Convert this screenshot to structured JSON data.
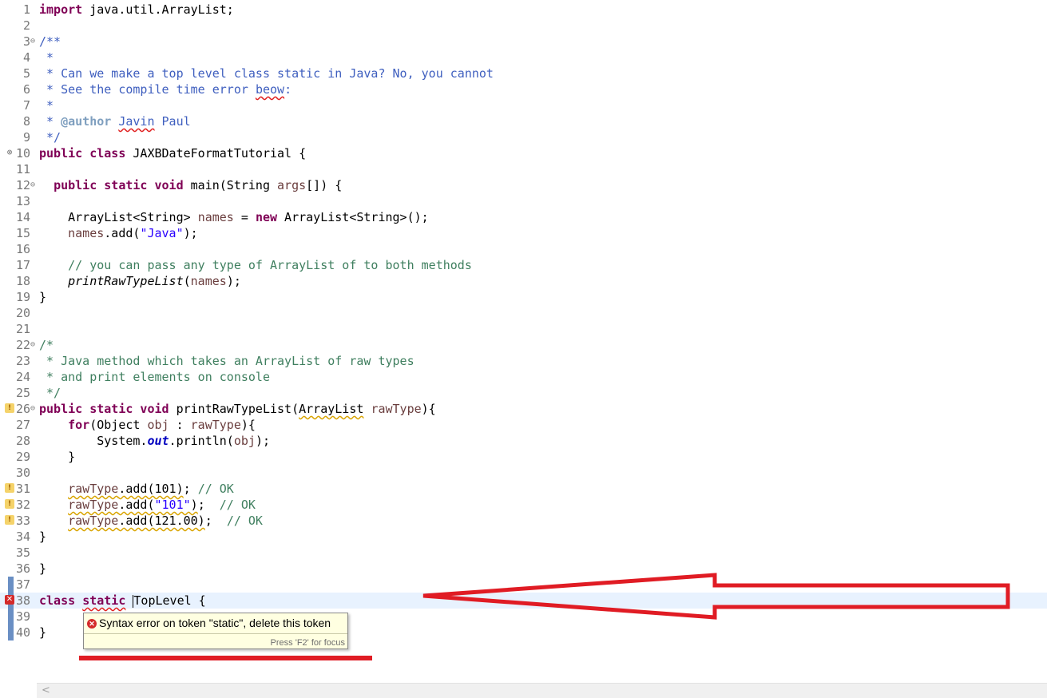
{
  "editor": {
    "lines": [
      {
        "n": "1",
        "fold": "",
        "marker": "",
        "html": "<span class=\"kw\">import</span> java.util.ArrayList;"
      },
      {
        "n": "2",
        "fold": "",
        "marker": "",
        "html": ""
      },
      {
        "n": "3",
        "fold": "⊖",
        "marker": "",
        "html": "<span class=\"jd\">/**</span>"
      },
      {
        "n": "4",
        "fold": "",
        "marker": "",
        "html": "<span class=\"jd\"> *</span>"
      },
      {
        "n": "5",
        "fold": "",
        "marker": "",
        "html": "<span class=\"jd\"> * Can we make a top level class static in Java? No, you cannot</span>"
      },
      {
        "n": "6",
        "fold": "",
        "marker": "",
        "html": "<span class=\"jd\"> * See the compile time error <span class=\"squiggle-err\">beow</span>:</span>"
      },
      {
        "n": "7",
        "fold": "",
        "marker": "",
        "html": "<span class=\"jd\"> *</span>"
      },
      {
        "n": "8",
        "fold": "",
        "marker": "",
        "html": "<span class=\"jd\"> * <span class=\"jdtag\">@author</span> <span class=\"squiggle-err\">Javin</span> Paul</span>"
      },
      {
        "n": "9",
        "fold": "",
        "marker": "",
        "html": "<span class=\"jd\"> */</span>"
      },
      {
        "n": "10",
        "fold": "",
        "marker": "err-outline",
        "html": "<span class=\"kw\">public class</span> JAXBDateFormatTutorial {"
      },
      {
        "n": "11",
        "fold": "",
        "marker": "",
        "html": ""
      },
      {
        "n": "12",
        "fold": "⊖",
        "marker": "",
        "html": "  <span class=\"kw\">public static void</span> main(String <span class=\"var\">args</span>[]) {"
      },
      {
        "n": "13",
        "fold": "",
        "marker": "",
        "html": ""
      },
      {
        "n": "14",
        "fold": "",
        "marker": "",
        "html": "    ArrayList&lt;String&gt; <span class=\"var\">names</span> = <span class=\"kw\">new</span> ArrayList&lt;String&gt;();"
      },
      {
        "n": "15",
        "fold": "",
        "marker": "",
        "html": "    <span class=\"var\">names</span>.add(<span class=\"str\">\"Java\"</span>);"
      },
      {
        "n": "16",
        "fold": "",
        "marker": "",
        "html": ""
      },
      {
        "n": "17",
        "fold": "",
        "marker": "",
        "html": "    <span class=\"cm\">// you can pass any type of ArrayList of to both methods</span>"
      },
      {
        "n": "18",
        "fold": "",
        "marker": "",
        "html": "    <span class=\"it\">printRawTypeList</span>(<span class=\"var\">names</span>);"
      },
      {
        "n": "19",
        "fold": "",
        "marker": "",
        "html": "}"
      },
      {
        "n": "20",
        "fold": "",
        "marker": "",
        "html": ""
      },
      {
        "n": "21",
        "fold": "",
        "marker": "",
        "html": ""
      },
      {
        "n": "22",
        "fold": "⊖",
        "marker": "",
        "html": "<span class=\"cm\">/*</span>"
      },
      {
        "n": "23",
        "fold": "",
        "marker": "",
        "html": "<span class=\"cm\"> * Java method which takes an ArrayList of raw types</span>"
      },
      {
        "n": "24",
        "fold": "",
        "marker": "",
        "html": "<span class=\"cm\"> * and print elements on console</span>"
      },
      {
        "n": "25",
        "fold": "",
        "marker": "",
        "html": "<span class=\"cm\"> */</span>"
      },
      {
        "n": "26",
        "fold": "⊖",
        "marker": "warn",
        "html": "<span class=\"kw\">public static void</span> printRawTypeList(<span class=\"squiggle-warn\">ArrayList</span> <span class=\"var\">rawType</span>){"
      },
      {
        "n": "27",
        "fold": "",
        "marker": "",
        "html": "    <span class=\"kw\">for</span>(Object <span class=\"var\">obj</span> : <span class=\"var\">rawType</span>){"
      },
      {
        "n": "28",
        "fold": "",
        "marker": "",
        "html": "        System.<span class=\"fld\">out</span>.println(<span class=\"var\">obj</span>);"
      },
      {
        "n": "29",
        "fold": "",
        "marker": "",
        "html": "    }"
      },
      {
        "n": "30",
        "fold": "",
        "marker": "",
        "html": ""
      },
      {
        "n": "31",
        "fold": "",
        "marker": "warn",
        "html": "    <span class=\"squiggle-warn\"><span class=\"var\">rawType</span>.add(101)</span>; <span class=\"cm\">// OK</span>"
      },
      {
        "n": "32",
        "fold": "",
        "marker": "warn",
        "html": "    <span class=\"squiggle-warn\"><span class=\"var\">rawType</span>.add(<span class=\"str\">\"101\"</span>)</span>;  <span class=\"cm\">// OK</span>"
      },
      {
        "n": "33",
        "fold": "",
        "marker": "warn",
        "html": "    <span class=\"squiggle-warn\"><span class=\"var\">rawType</span>.add(121.00)</span>;  <span class=\"cm\">// OK</span>"
      },
      {
        "n": "34",
        "fold": "",
        "marker": "",
        "html": "}"
      },
      {
        "n": "35",
        "fold": "",
        "marker": "",
        "html": ""
      },
      {
        "n": "36",
        "fold": "",
        "marker": "",
        "html": "}"
      },
      {
        "n": "37",
        "fold": "",
        "marker": "change",
        "html": ""
      },
      {
        "n": "38",
        "fold": "",
        "marker": "error",
        "current": true,
        "html": "<span class=\"kw\">class</span> <span class=\"kw squiggle-err\">static</span> <span class=\"caret\"></span>TopLevel {"
      },
      {
        "n": "39",
        "fold": "",
        "marker": "change",
        "html": ""
      },
      {
        "n": "40",
        "fold": "",
        "marker": "change",
        "html": "}"
      }
    ]
  },
  "hover": {
    "message": "Syntax error on token \"static\", delete this token",
    "focus_hint": "Press 'F2' for focus"
  },
  "annotation_color": "#e01c24",
  "scrollbar": {
    "left_arrow": "<"
  }
}
